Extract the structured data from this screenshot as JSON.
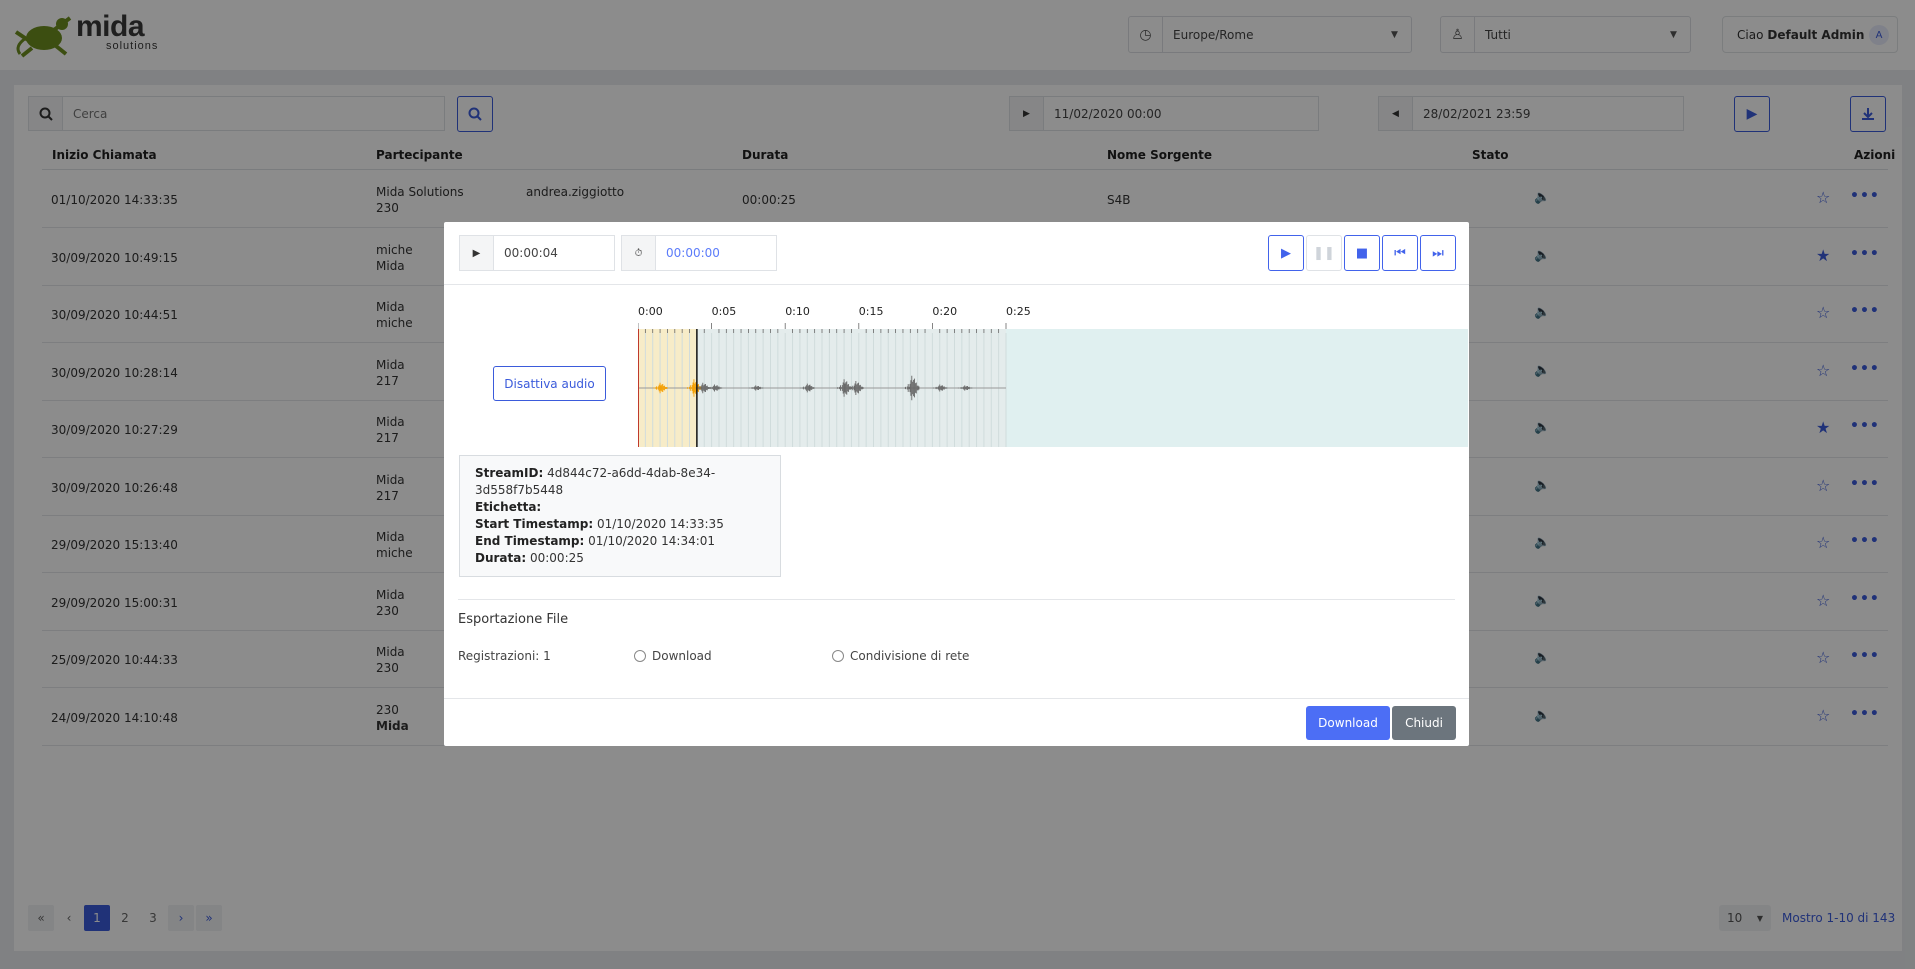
{
  "header": {
    "logo_brand": "mida",
    "logo_sub": "solutions",
    "timezone": "Europe/Rome",
    "group_filter": "Tutti",
    "greeting": "Ciao",
    "user_name": "Default Admin",
    "avatar_initial": "A"
  },
  "toolbar": {
    "search_placeholder": "Cerca",
    "date_from": "11/02/2020 00:00",
    "date_to": "28/02/2021 23:59"
  },
  "table": {
    "columns": [
      "Inizio Chiamata",
      "Partecipante",
      "Durata",
      "Nome Sorgente",
      "Stato",
      "Azioni"
    ],
    "rows": [
      {
        "start": "01/10/2020 14:33:35",
        "p1": "Mida Solutions",
        "p2": "230",
        "p3": "andrea.ziggiotto",
        "duration": "00:00:25",
        "source": "S4B",
        "starred": false
      },
      {
        "start": "30/09/2020 10:49:15",
        "p1": "miche",
        "p2": "Mida",
        "starred": true
      },
      {
        "start": "30/09/2020 10:44:51",
        "p1": "Mida",
        "p2": "miche",
        "starred": false
      },
      {
        "start": "30/09/2020 10:28:14",
        "p1": "Mida",
        "p2": "217",
        "starred": false
      },
      {
        "start": "30/09/2020 10:27:29",
        "p1": "Mida",
        "p2": "217",
        "starred": true
      },
      {
        "start": "30/09/2020 10:26:48",
        "p1": "Mida",
        "p2": "217",
        "starred": false
      },
      {
        "start": "29/09/2020 15:13:40",
        "p1": "Mida",
        "p2": "miche",
        "starred": false
      },
      {
        "start": "29/09/2020 15:00:31",
        "p1": "Mida",
        "p2": "230",
        "starred": false
      },
      {
        "start": "25/09/2020 10:44:33",
        "p1": "Mida",
        "p2": "230",
        "starred": false
      },
      {
        "start": "24/09/2020 14:10:48",
        "p1": "230",
        "p2": "Mida",
        "starred": false
      }
    ]
  },
  "pagination": {
    "pages": [
      "1",
      "2",
      "3"
    ],
    "current": "1",
    "per_page": "10",
    "summary": "Mostro 1-10 di 143"
  },
  "modal": {
    "position_time": "00:00:04",
    "timer_value": "00:00:00",
    "mute_label": "Disattiva audio",
    "timeline_ticks": [
      "0:00",
      "0:05",
      "0:10",
      "0:15",
      "0:20",
      "0:25"
    ],
    "total_seconds": 25,
    "played_seconds": 4,
    "info": {
      "stream_id_label": "StreamID:",
      "stream_id": "4d844c72-a6dd-4dab-8e34-3d558f7b5448",
      "label_label": "Etichetta:",
      "label_value": "",
      "start_label": "Start Timestamp:",
      "start_value": "01/10/2020 14:33:35",
      "end_label": "End Timestamp:",
      "end_value": "01/10/2020 14:34:01",
      "duration_label": "Durata:",
      "duration_value": "00:00:25"
    },
    "export_title": "Esportazione File",
    "recordings": "Registrazioni: 1",
    "opt_download": "Download",
    "opt_network": "Condivisione di rete",
    "btn_download": "Download",
    "btn_close": "Chiudi"
  },
  "colors": {
    "accent": "#3b5bdb",
    "played": "#f59f00",
    "wave_bg": "#e0f0f0",
    "status_ok": "#2f9e44"
  }
}
